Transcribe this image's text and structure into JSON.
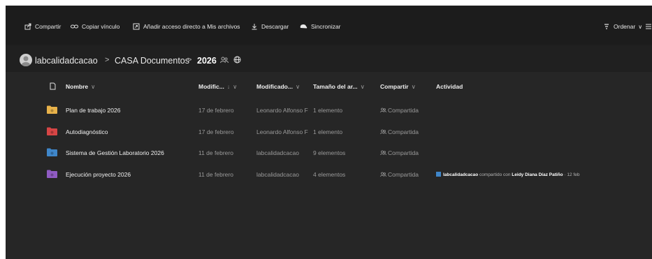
{
  "toolbar": {
    "share": "Compartir",
    "copy_link": "Copiar vínculo",
    "add_shortcut": "Añadir acceso directo a Mis archivos",
    "download": "Descargar",
    "sync": "Sincronizar",
    "sort": "Ordenar"
  },
  "breadcrumb": {
    "root": "labcalidadcacao",
    "parent": "CASA Documentos",
    "current": "2026",
    "separator": ">"
  },
  "columns": {
    "name": "Nombre",
    "modified": "Modific...",
    "modified_by": "Modificado...",
    "size": "Tamaño del ar...",
    "sharing": "Compartir",
    "activity": "Actividad"
  },
  "rows": [
    {
      "name": "Plan de trabajo 2026",
      "modified": "17 de febrero",
      "modified_by": "Leonardo Alfonso F",
      "size": "1 elemento",
      "sharing": "Compartida",
      "folder_color": "#e8b24a"
    },
    {
      "name": "Autodiagnóstico",
      "modified": "17 de febrero",
      "modified_by": "Leonardo Alfonso F",
      "size": "1 elemento",
      "sharing": "Compartida",
      "folder_color": "#d64545"
    },
    {
      "name": "Sistema de Gestión Laboratorio 2026",
      "modified": "11 de febrero",
      "modified_by": "labcalidadcacao",
      "size": "9 elementos",
      "sharing": "Compartida",
      "folder_color": "#3f86c9"
    },
    {
      "name": "Ejecución proyecto 2026",
      "modified": "11 de febrero",
      "modified_by": "labcalidadcacao",
      "size": "4 elementos",
      "sharing": "Compartida",
      "folder_color": "#8f5bc2"
    }
  ],
  "activity_row": {
    "user": "labcalidadcacao",
    "action": "compartido con",
    "target": "Leidy Diana Díaz Patiño",
    "date": "· 12 feb"
  },
  "colors": {
    "background": "#1f1f1f",
    "list": "#262626",
    "text": "#e6e6e6"
  }
}
